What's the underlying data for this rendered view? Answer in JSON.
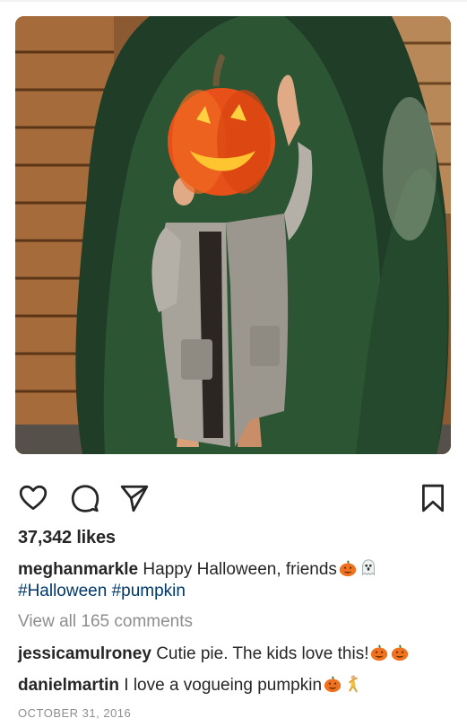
{
  "post": {
    "likes": "37,342 likes",
    "caption": {
      "username": "meghanmarkle",
      "text": "Happy Halloween, friends",
      "emojis": [
        "jack-o-lantern",
        "ghost"
      ],
      "hashtags": "#Halloween #pumpkin"
    },
    "view_all": "View all 165 comments",
    "comments": [
      {
        "username": "jessicamulroney",
        "text": "Cutie pie. The kids love this!",
        "emojis": [
          "jack-o-lantern",
          "jack-o-lantern"
        ]
      },
      {
        "username": "danielmartin",
        "text": "I love a vogueing pumpkin",
        "emojis": [
          "jack-o-lantern",
          "dancer"
        ]
      }
    ],
    "date": "OCTOBER 31, 2016"
  },
  "icons": {
    "like": "heart-icon",
    "comment": "comment-bubble-icon",
    "share": "paper-plane-icon",
    "save": "bookmark-icon"
  },
  "colors": {
    "text": "#262626",
    "hashtag": "#00376b",
    "muted": "#8e8e8e",
    "pumpkin": "#e8501a"
  }
}
